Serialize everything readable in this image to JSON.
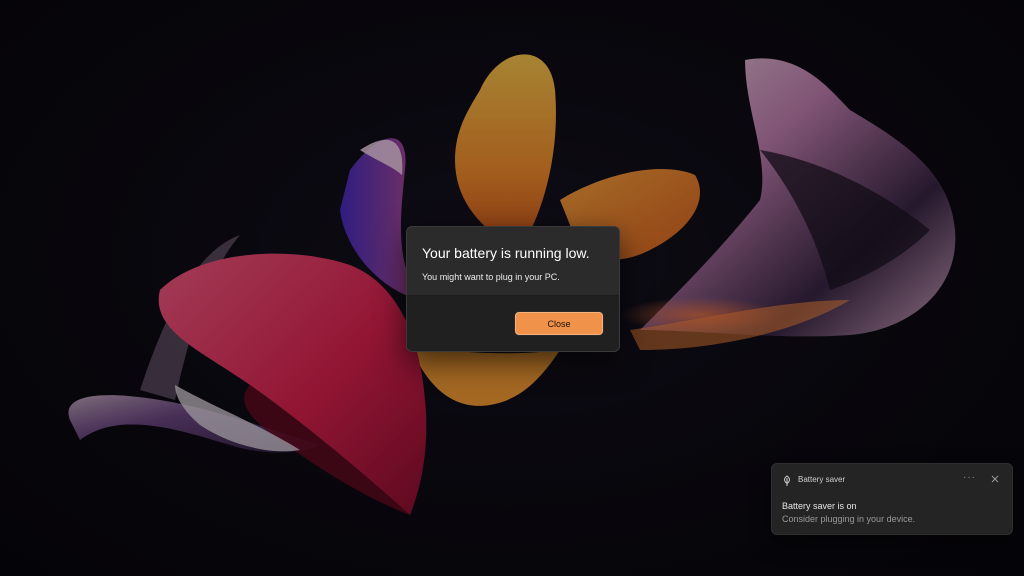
{
  "dialog": {
    "title": "Your battery is running low.",
    "message": "You might want to plug in your PC.",
    "close_label": "Close",
    "accent_color": "#f0924a"
  },
  "toast": {
    "app_icon": "battery-saver-leaf-icon",
    "app_name": "Battery saver",
    "more_label": "···",
    "close_icon": "close-icon",
    "title": "Battery saver is on",
    "message": "Consider plugging in your device."
  },
  "wallpaper": {
    "icon": "windows-bloom-wallpaper",
    "colors": [
      "#e8416a",
      "#f5a33b",
      "#f0c25a",
      "#b44cc8",
      "#6c5bd6"
    ]
  }
}
